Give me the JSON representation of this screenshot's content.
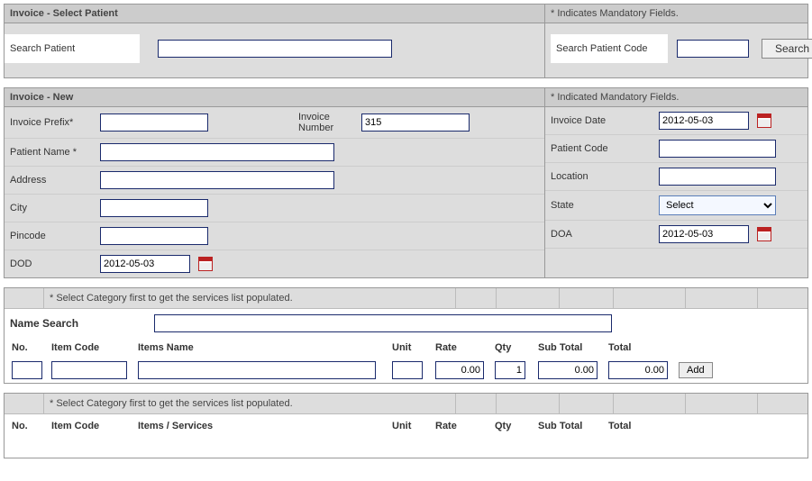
{
  "select": {
    "title": "Invoice - Select Patient",
    "mandatory_hint": "* Indicates Mandatory Fields.",
    "search_patient_label": "Search Patient",
    "search_patient_value": "",
    "search_code_label": "Search Patient Code",
    "search_code_value": "",
    "search_button": "Search"
  },
  "invoice": {
    "title": "Invoice - New",
    "mandatory_hint": "* Indicated Mandatory Fields.",
    "prefix_label": "Invoice Prefix*",
    "prefix_value": "",
    "number_label": "Invoice Number",
    "number_value": "315",
    "date_label": "Invoice Date",
    "date_value": "2012-05-03",
    "patient_name_label": "Patient Name *",
    "patient_name_value": "",
    "patient_code_label": "Patient Code",
    "patient_code_value": "",
    "address_label": "Address",
    "address_value": "",
    "location_label": "Location",
    "location_value": "",
    "city_label": "City",
    "city_value": "",
    "state_label": "State",
    "state_value": "Select",
    "pincode_label": "Pincode",
    "pincode_value": "",
    "doa_label": "DOA",
    "doa_value": "2012-05-03",
    "dod_label": "DOD",
    "dod_value": "2012-05-03"
  },
  "items": {
    "hint": "* Select Category first to get the services list populated.",
    "name_search_label": "Name Search",
    "name_search_value": "",
    "headers": {
      "no": "No.",
      "item_code": "Item Code",
      "items_name": "Items Name",
      "unit": "Unit",
      "rate": "Rate",
      "qty": "Qty",
      "sub_total": "Sub Total",
      "total": "Total"
    },
    "row": {
      "no": "",
      "code": "",
      "name": "",
      "unit": "",
      "rate": "0.00",
      "qty": "1",
      "sub": "0.00",
      "tot": "0.00"
    },
    "add_button": "Add"
  },
  "summary": {
    "hint": "* Select Category first to get the services list populated.",
    "headers": {
      "no": "No.",
      "item_code": "Item Code",
      "items_services": "Items / Services",
      "unit": "Unit",
      "rate": "Rate",
      "qty": "Qty",
      "sub_total": "Sub Total",
      "total": "Total"
    }
  }
}
